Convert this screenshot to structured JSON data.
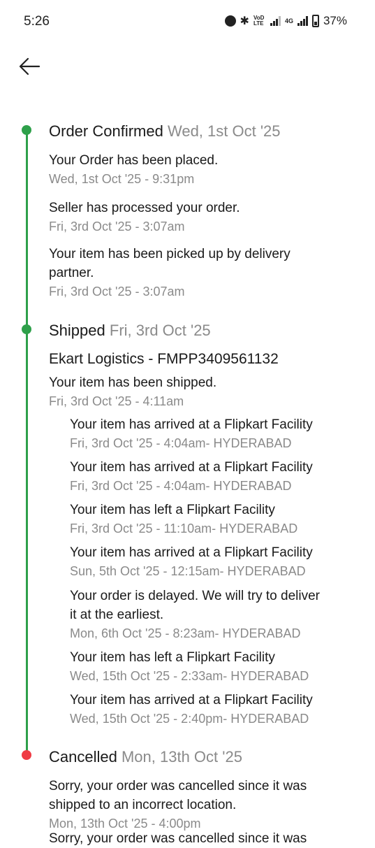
{
  "status_bar": {
    "time": "5:26",
    "volte": "VoD LTE",
    "network": "4G",
    "battery": "37%"
  },
  "colors": {
    "green": "#2ea04a",
    "red": "#ef3b44",
    "muted": "#8a8a8a"
  },
  "timeline": {
    "order_confirmed": {
      "title": "Order Confirmed",
      "date": "Wed, 1st Oct '25",
      "events": [
        {
          "text": "Your Order has been placed.",
          "time": "Wed, 1st Oct '25 - 9:31pm"
        },
        {
          "text": "Seller has processed your order.",
          "time": "Fri, 3rd Oct '25 - 3:07am"
        },
        {
          "text": "Your item has been picked up by delivery partner.",
          "time": "Fri, 3rd Oct '25 - 3:07am"
        }
      ]
    },
    "shipped": {
      "title": "Shipped",
      "date": "Fri, 3rd Oct '25",
      "carrier": "Ekart Logistics - FMPP3409561132",
      "event": {
        "text": "Your item has been shipped.",
        "time": "Fri, 3rd Oct '25 - 4:11am"
      },
      "sub_events": [
        {
          "text": "Your item has arrived at a Flipkart Facility",
          "time": "Fri, 3rd Oct '25 - 4:04am- HYDERABAD"
        },
        {
          "text": "Your item has arrived at a Flipkart Facility",
          "time": "Fri, 3rd Oct '25 - 4:04am- HYDERABAD"
        },
        {
          "text": "Your item has left a Flipkart Facility",
          "time": "Fri, 3rd Oct '25 - 11:10am- HYDERABAD"
        },
        {
          "text": "Your item has arrived at a Flipkart Facility",
          "time": "Sun, 5th Oct '25 - 12:15am- HYDERABAD"
        },
        {
          "text": "Your order is delayed. We will try to deliver it at the earliest.",
          "time": "Mon, 6th Oct '25 - 8:23am- HYDERABAD"
        },
        {
          "text": "Your item has left a Flipkart Facility",
          "time": "Wed, 15th Oct '25 - 2:33am- HYDERABAD"
        },
        {
          "text": "Your item has arrived at a Flipkart Facility",
          "time": "Wed, 15th Oct '25 - 2:40pm- HYDERABAD"
        }
      ]
    },
    "cancelled": {
      "title": "Cancelled",
      "date": "Mon, 13th Oct '25",
      "events": [
        {
          "text": "Sorry, your order was cancelled since it was shipped to an incorrect location.",
          "time": "Mon, 13th Oct '25 - 4:00pm"
        },
        {
          "text": "Sorry, your order was cancelled since it was",
          "time": ""
        }
      ]
    }
  }
}
